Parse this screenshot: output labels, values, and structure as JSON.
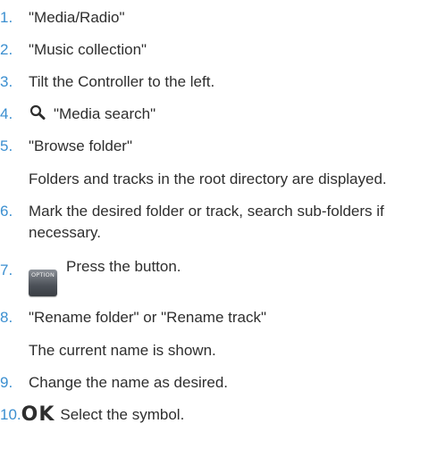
{
  "steps": [
    {
      "number": "1.",
      "text": "\"Media/Radio\""
    },
    {
      "number": "2.",
      "text": "\"Music collection\""
    },
    {
      "number": "3.",
      "text": "Tilt the Controller to the left."
    },
    {
      "number": "4.",
      "icon": "search-icon",
      "text": "\"Media search\""
    },
    {
      "number": "5.",
      "text": "\"Browse folder\"",
      "note": "Folders and tracks in the root directory are displayed."
    },
    {
      "number": "6.",
      "text": "Mark the desired folder or track, search sub-folders if necessary."
    },
    {
      "number": "7.",
      "button_label": "OPTION",
      "text": "Press the button."
    },
    {
      "number": "8.",
      "text": "\"Rename folder\" or \"Rename track\"",
      "note": "The current name is shown."
    },
    {
      "number": "9.",
      "text": "Change the name as desired."
    },
    {
      "number": "10.",
      "symbol": "OK",
      "text": "Select the symbol."
    }
  ],
  "colors": {
    "step_number": "#3b8fd0",
    "body_text": "#2e2e2e"
  }
}
